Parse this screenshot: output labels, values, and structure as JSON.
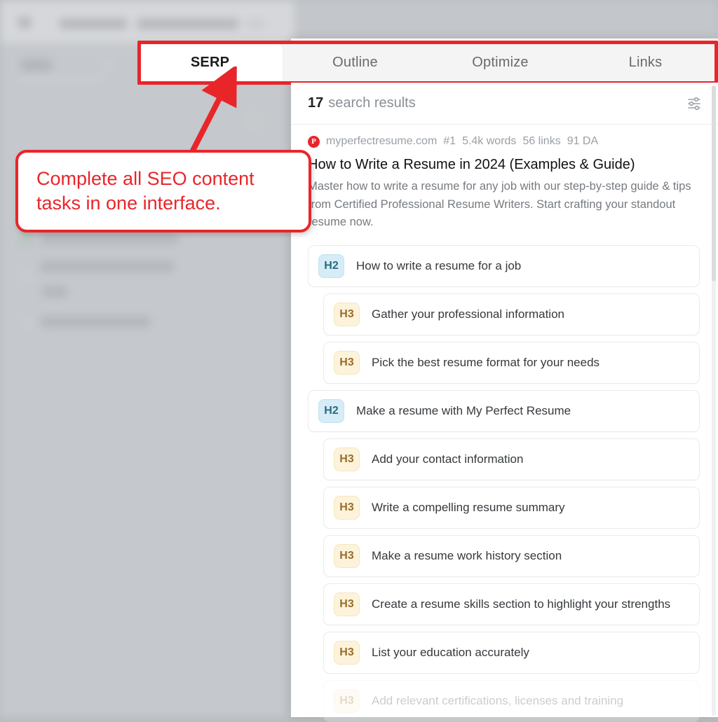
{
  "annotation": {
    "callout_text": "Complete all SEO content tasks in one interface.",
    "accent_color": "#e8262a",
    "arrow": "arrow-up-right-icon"
  },
  "tabs": [
    {
      "label": "SERP",
      "active": true
    },
    {
      "label": "Outline",
      "active": false
    },
    {
      "label": "Optimize",
      "active": false
    },
    {
      "label": "Links",
      "active": false
    }
  ],
  "results_header": {
    "count": "17",
    "label": "search results",
    "filter_icon": "sliders-icon"
  },
  "result": {
    "favicon_letter": "P",
    "favicon_color": "#e8262a",
    "domain": "myperfectresume.com",
    "rank": "#1",
    "words": "5.4k words",
    "links": "56 links",
    "authority": "91 DA",
    "title": "How to Write a Resume in 2024 (Examples & Guide)",
    "description": "Master how to write a resume for any job with our step-by-step guide & tips from Certified Professional Resume Writers. Start crafting your standout resume now."
  },
  "outline": [
    {
      "level": "H2",
      "text": "How to write a resume for a job",
      "faded": false
    },
    {
      "level": "H3",
      "text": "Gather your professional information",
      "faded": false
    },
    {
      "level": "H3",
      "text": "Pick the best resume format for your needs",
      "faded": false
    },
    {
      "level": "H2",
      "text": "Make a resume with My Perfect Resume",
      "faded": false
    },
    {
      "level": "H3",
      "text": "Add your contact information",
      "faded": false
    },
    {
      "level": "H3",
      "text": "Write a compelling resume summary",
      "faded": false
    },
    {
      "level": "H3",
      "text": "Make a resume work history section",
      "faded": false
    },
    {
      "level": "H3",
      "text": "Create a resume skills section to highlight your strengths",
      "faded": false
    },
    {
      "level": "H3",
      "text": "List your education accurately",
      "faded": false
    },
    {
      "level": "H3",
      "text": "Add relevant certifications, licenses and training",
      "faded": true
    }
  ],
  "colors": {
    "h2_badge_bg": "#d6ecf6",
    "h2_badge_text": "#2a6b85",
    "h3_badge_bg": "#fdf3db",
    "h3_badge_text": "#9a6c2c",
    "panel_bg": "#ffffff",
    "tabbar_bg": "#f4f4f4"
  }
}
